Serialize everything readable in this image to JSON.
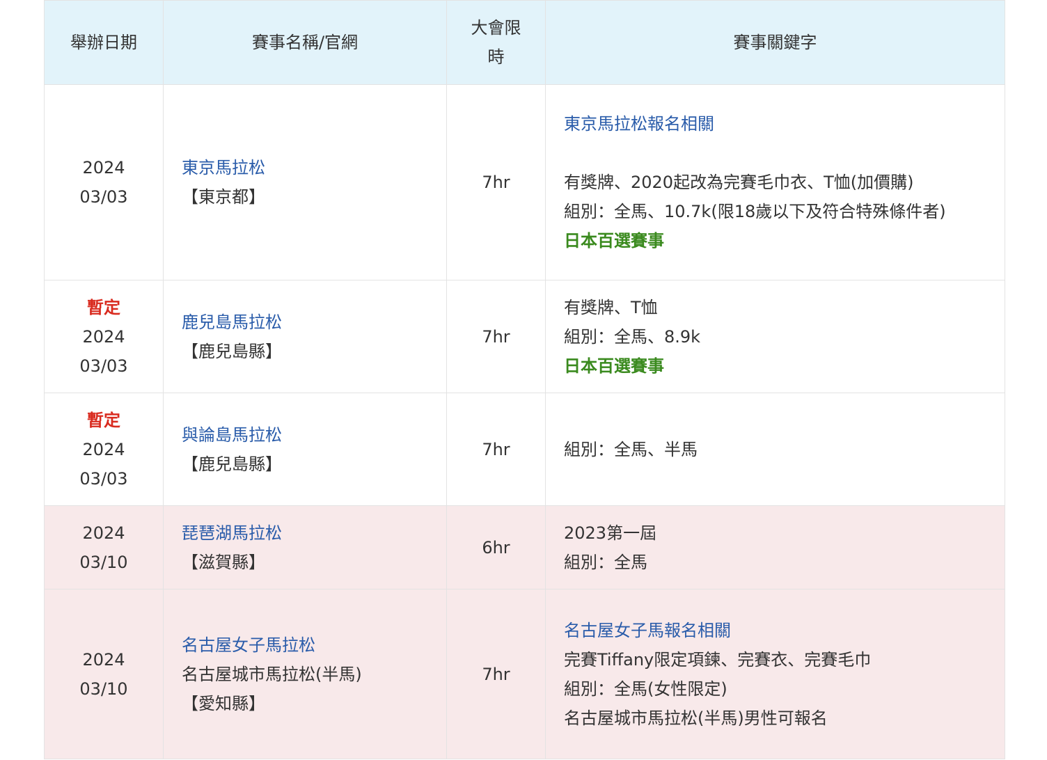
{
  "headers": {
    "date": "舉辦日期",
    "name": "賽事名稱/官網",
    "limit_line1": "大會限",
    "limit_line2": "時",
    "keywords": "賽事關鍵字"
  },
  "rows": [
    {
      "date_year": "2024",
      "date_md": "03/03",
      "name": "東京馬拉松",
      "prefecture": "【東京都】",
      "limit": "7hr",
      "kw_link": "東京馬拉松報名相關",
      "kw_lines": [
        "有獎牌、2020起改為完賽毛巾衣、T恤(加價購)",
        "組別：全馬、10.7k(限18歲以下及符合特殊條件者)"
      ],
      "kw_green": "日本百選賽事"
    },
    {
      "status": "暫定",
      "date_year": "2024",
      "date_md": "03/03",
      "name": "鹿兒島馬拉松",
      "prefecture": "【鹿兒島縣】",
      "limit": "7hr",
      "kw_lines": [
        "有獎牌、T恤",
        "組別：全馬、8.9k"
      ],
      "kw_green": "日本百選賽事"
    },
    {
      "status": "暫定",
      "date_year": "2024",
      "date_md": "03/03",
      "name": "與論島馬拉松",
      "prefecture": "【鹿兒島縣】",
      "limit": "7hr",
      "kw_lines": [
        "組別：全馬、半馬"
      ]
    },
    {
      "date_year": "2024",
      "date_md": "03/10",
      "name": "琵琶湖馬拉松",
      "prefecture": "【滋賀縣】",
      "limit": "6hr",
      "kw_lines": [
        "2023第一屆",
        "組別：全馬"
      ]
    },
    {
      "date_year": "2024",
      "date_md": "03/10",
      "name": "名古屋女子馬拉松",
      "sub_name": "名古屋城市馬拉松(半馬)",
      "prefecture": "【愛知縣】",
      "limit": "7hr",
      "kw_link": "名古屋女子馬報名相關",
      "kw_lines": [
        "完賽Tiffany限定項鍊、完賽衣、完賽毛巾",
        "組別：全馬(女性限定)",
        "名古屋城市馬拉松(半馬)男性可報名"
      ]
    }
  ],
  "colors": {
    "header_bg": "#e2f3fa",
    "highlight_row_bg": "#f8e9ea",
    "link_blue": "#2a5caa",
    "status_red": "#d92b1f",
    "tag_green": "#3a8a1e"
  }
}
